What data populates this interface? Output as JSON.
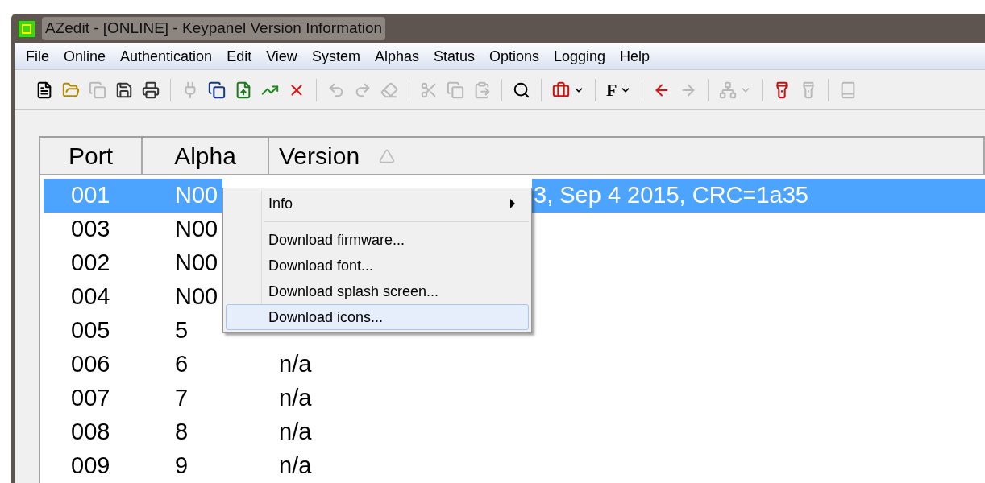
{
  "window": {
    "title": "AZedit - [ONLINE] - Keypanel Version Information"
  },
  "menu_bar": [
    "File",
    "Online",
    "Authentication",
    "Edit",
    "View",
    "System",
    "Alphas",
    "Status",
    "Options",
    "Logging",
    "Help"
  ],
  "toolbar": [
    {
      "kind": "new",
      "disabled": false
    },
    {
      "kind": "open",
      "disabled": false
    },
    {
      "kind": "copy",
      "disabled": true
    },
    {
      "kind": "save",
      "disabled": false
    },
    {
      "kind": "print",
      "disabled": false
    },
    {
      "kind": "separator"
    },
    {
      "kind": "connect",
      "disabled": true
    },
    {
      "kind": "copy",
      "disabled": false
    },
    {
      "kind": "export",
      "disabled": false
    },
    {
      "kind": "trend",
      "disabled": false
    },
    {
      "kind": "delete",
      "disabled": false
    },
    {
      "kind": "separator"
    },
    {
      "kind": "undo",
      "disabled": true
    },
    {
      "kind": "redo",
      "disabled": true
    },
    {
      "kind": "eraser",
      "disabled": true
    },
    {
      "kind": "separator"
    },
    {
      "kind": "cut",
      "disabled": true
    },
    {
      "kind": "copy",
      "disabled": true
    },
    {
      "kind": "paste",
      "disabled": true
    },
    {
      "kind": "separator"
    },
    {
      "kind": "search",
      "disabled": false
    },
    {
      "kind": "separator"
    },
    {
      "kind": "toolbox",
      "disabled": false,
      "dropdown": true
    },
    {
      "kind": "separator"
    },
    {
      "kind": "text",
      "label": "F",
      "disabled": false,
      "dropdown": true
    },
    {
      "kind": "separator"
    },
    {
      "kind": "back",
      "disabled": false
    },
    {
      "kind": "forward",
      "disabled": true
    },
    {
      "kind": "separator"
    },
    {
      "kind": "network",
      "disabled": true,
      "dropdown": true
    },
    {
      "kind": "separator"
    },
    {
      "kind": "flashlight",
      "disabled": false
    },
    {
      "kind": "flashlight",
      "disabled": true
    },
    {
      "kind": "separator"
    },
    {
      "kind": "book",
      "disabled": true
    }
  ],
  "table": {
    "columns": [
      {
        "label": "Port",
        "sorted": false
      },
      {
        "label": "Alpha",
        "sorted": false
      },
      {
        "label": "Version",
        "sorted": true
      }
    ],
    "rows": [
      {
        "port": "001",
        "alpha": "N00",
        "version": "3, Sep  4 2015, CRC=1a35",
        "selected": true
      },
      {
        "port": "003",
        "alpha": "N00",
        "selected": false
      },
      {
        "port": "002",
        "alpha": "N00",
        "selected": false
      },
      {
        "port": "004",
        "alpha": "N00",
        "selected": false
      },
      {
        "port": "005",
        "alpha": "5",
        "selected": false
      },
      {
        "port": "006",
        "alpha": "6",
        "version": "n/a",
        "selected": false
      },
      {
        "port": "007",
        "alpha": "7",
        "version": "n/a",
        "selected": false
      },
      {
        "port": "008",
        "alpha": "8",
        "version": "n/a",
        "selected": false
      },
      {
        "port": "009",
        "alpha": "9",
        "version": "n/a",
        "selected": false
      }
    ]
  },
  "context_menu": [
    {
      "kind": "submenu",
      "label": "Info",
      "selected": false
    },
    {
      "kind": "separator"
    },
    {
      "kind": "item",
      "label": "Download firmware...",
      "selected": false
    },
    {
      "kind": "item",
      "label": "Download font...",
      "selected": false
    },
    {
      "kind": "item",
      "label": "Download splash screen...",
      "selected": false
    },
    {
      "kind": "item",
      "label": "Download icons...",
      "selected": true
    }
  ]
}
